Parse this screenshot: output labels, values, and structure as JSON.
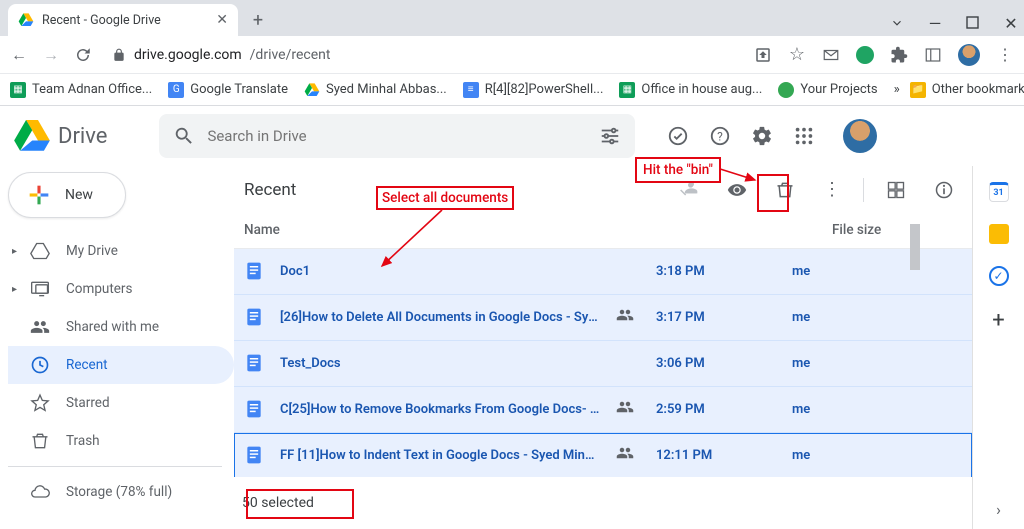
{
  "window": {
    "tab_title": "Recent - Google Drive",
    "url_host": "drive.google.com",
    "url_path": "/drive/recent"
  },
  "bookmarks": {
    "b0": "Team Adnan Office...",
    "b1": "Google Translate",
    "b2": "Syed Minhal Abbas...",
    "b3": "R[4][82]PowerShell...",
    "b4": "Office in house aug...",
    "b5": "Your Projects",
    "overflow": "»",
    "other": "Other bookmarks"
  },
  "app": {
    "name": "Drive",
    "search_placeholder": "Search in Drive"
  },
  "sidebar": {
    "new_label": "New",
    "items": {
      "my_drive": "My Drive",
      "computers": "Computers",
      "shared": "Shared with me",
      "recent": "Recent",
      "starred": "Starred",
      "trash": "Trash",
      "storage": "Storage (78% full)"
    }
  },
  "page": {
    "title": "Recent",
    "col_name": "Name",
    "col_size": "File size",
    "selected": "50 selected"
  },
  "rows": [
    {
      "title": "Doc1",
      "shared": false,
      "time": "3:18 PM",
      "owner": "me"
    },
    {
      "title": "[26]How to Delete All Documents in Google Docs - Sye...",
      "shared": true,
      "time": "3:17 PM",
      "owner": "me"
    },
    {
      "title": "Test_Docs",
      "shared": false,
      "time": "3:06 PM",
      "owner": "me"
    },
    {
      "title": "C[25]How to Remove Bookmarks From Google Docs- S...",
      "shared": true,
      "time": "2:59 PM",
      "owner": "me"
    },
    {
      "title": "FF [11]How to Indent Text in Google Docs - Syed Minh...",
      "shared": true,
      "time": "12:11 PM",
      "owner": "me"
    }
  ],
  "annotations": {
    "select_all": "Select all documents",
    "hit_bin": "Hit the \"bin\""
  }
}
